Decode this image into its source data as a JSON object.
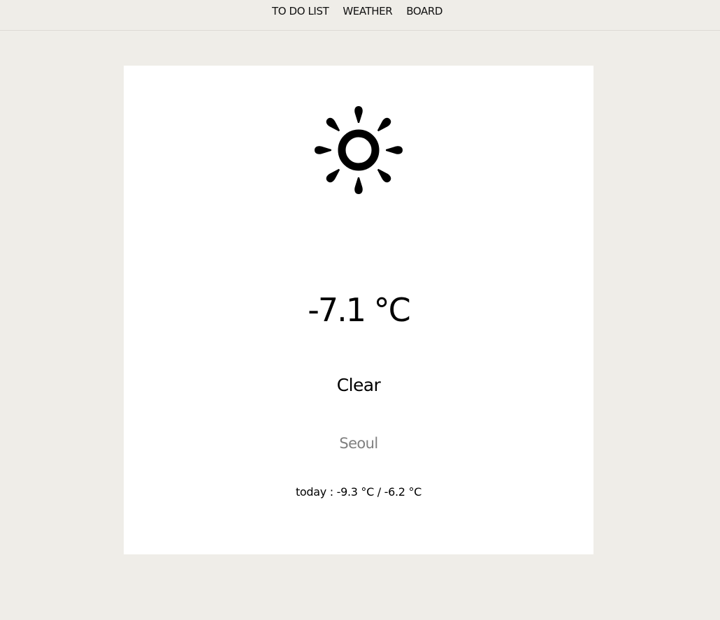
{
  "nav": {
    "items": [
      {
        "label": "TO DO LIST"
      },
      {
        "label": "WEATHER"
      },
      {
        "label": "BOARD"
      }
    ]
  },
  "weather": {
    "icon": "sun-icon",
    "temperature": "-7.1 °C",
    "condition": "Clear",
    "city": "Seoul",
    "today_range": "today : -9.3 °C / -6.2 °C"
  },
  "colors": {
    "page_background": "#efede8",
    "card_background": "#ffffff",
    "city_text": "#808080"
  }
}
